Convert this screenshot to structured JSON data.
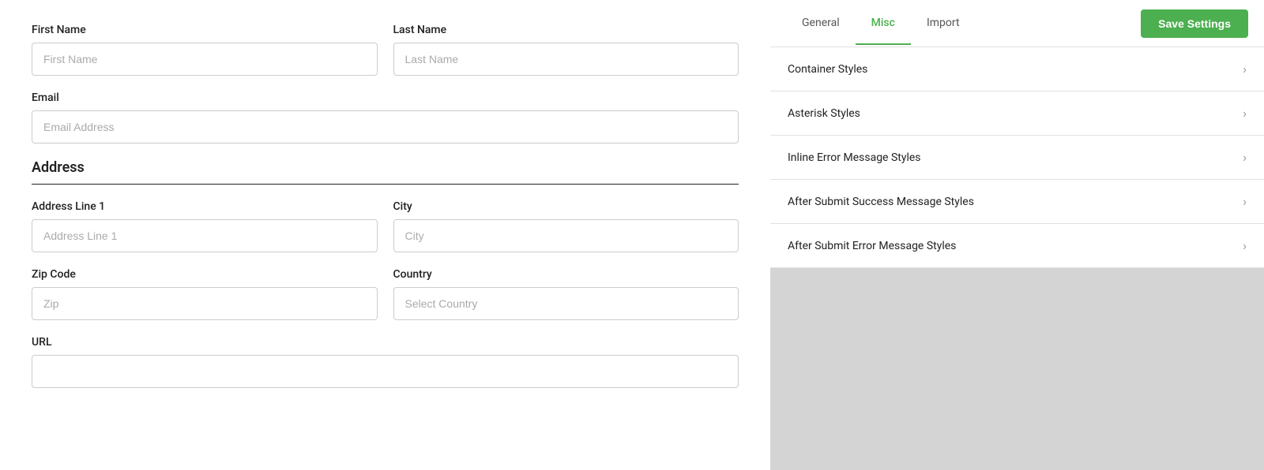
{
  "left": {
    "fields": {
      "first_name_label": "First Name",
      "first_name_placeholder": "First Name",
      "last_name_label": "Last Name",
      "last_name_placeholder": "Last Name",
      "email_label": "Email",
      "email_placeholder": "Email Address",
      "address_section": "Address",
      "address_line1_label": "Address Line 1",
      "address_line1_placeholder": "Address Line 1",
      "city_label": "City",
      "city_placeholder": "City",
      "zip_label": "Zip Code",
      "zip_placeholder": "Zip",
      "country_label": "Country",
      "country_placeholder": "Select Country",
      "url_label": "URL",
      "url_placeholder": ""
    }
  },
  "right": {
    "tabs": [
      {
        "label": "General",
        "active": false
      },
      {
        "label": "Misc",
        "active": true
      },
      {
        "label": "Import",
        "active": false
      }
    ],
    "save_button": "Save Settings",
    "accordion_items": [
      {
        "label": "Container Styles"
      },
      {
        "label": "Asterisk Styles"
      },
      {
        "label": "Inline Error Message Styles"
      },
      {
        "label": "After Submit Success Message Styles"
      },
      {
        "label": "After Submit Error Message Styles"
      }
    ]
  }
}
